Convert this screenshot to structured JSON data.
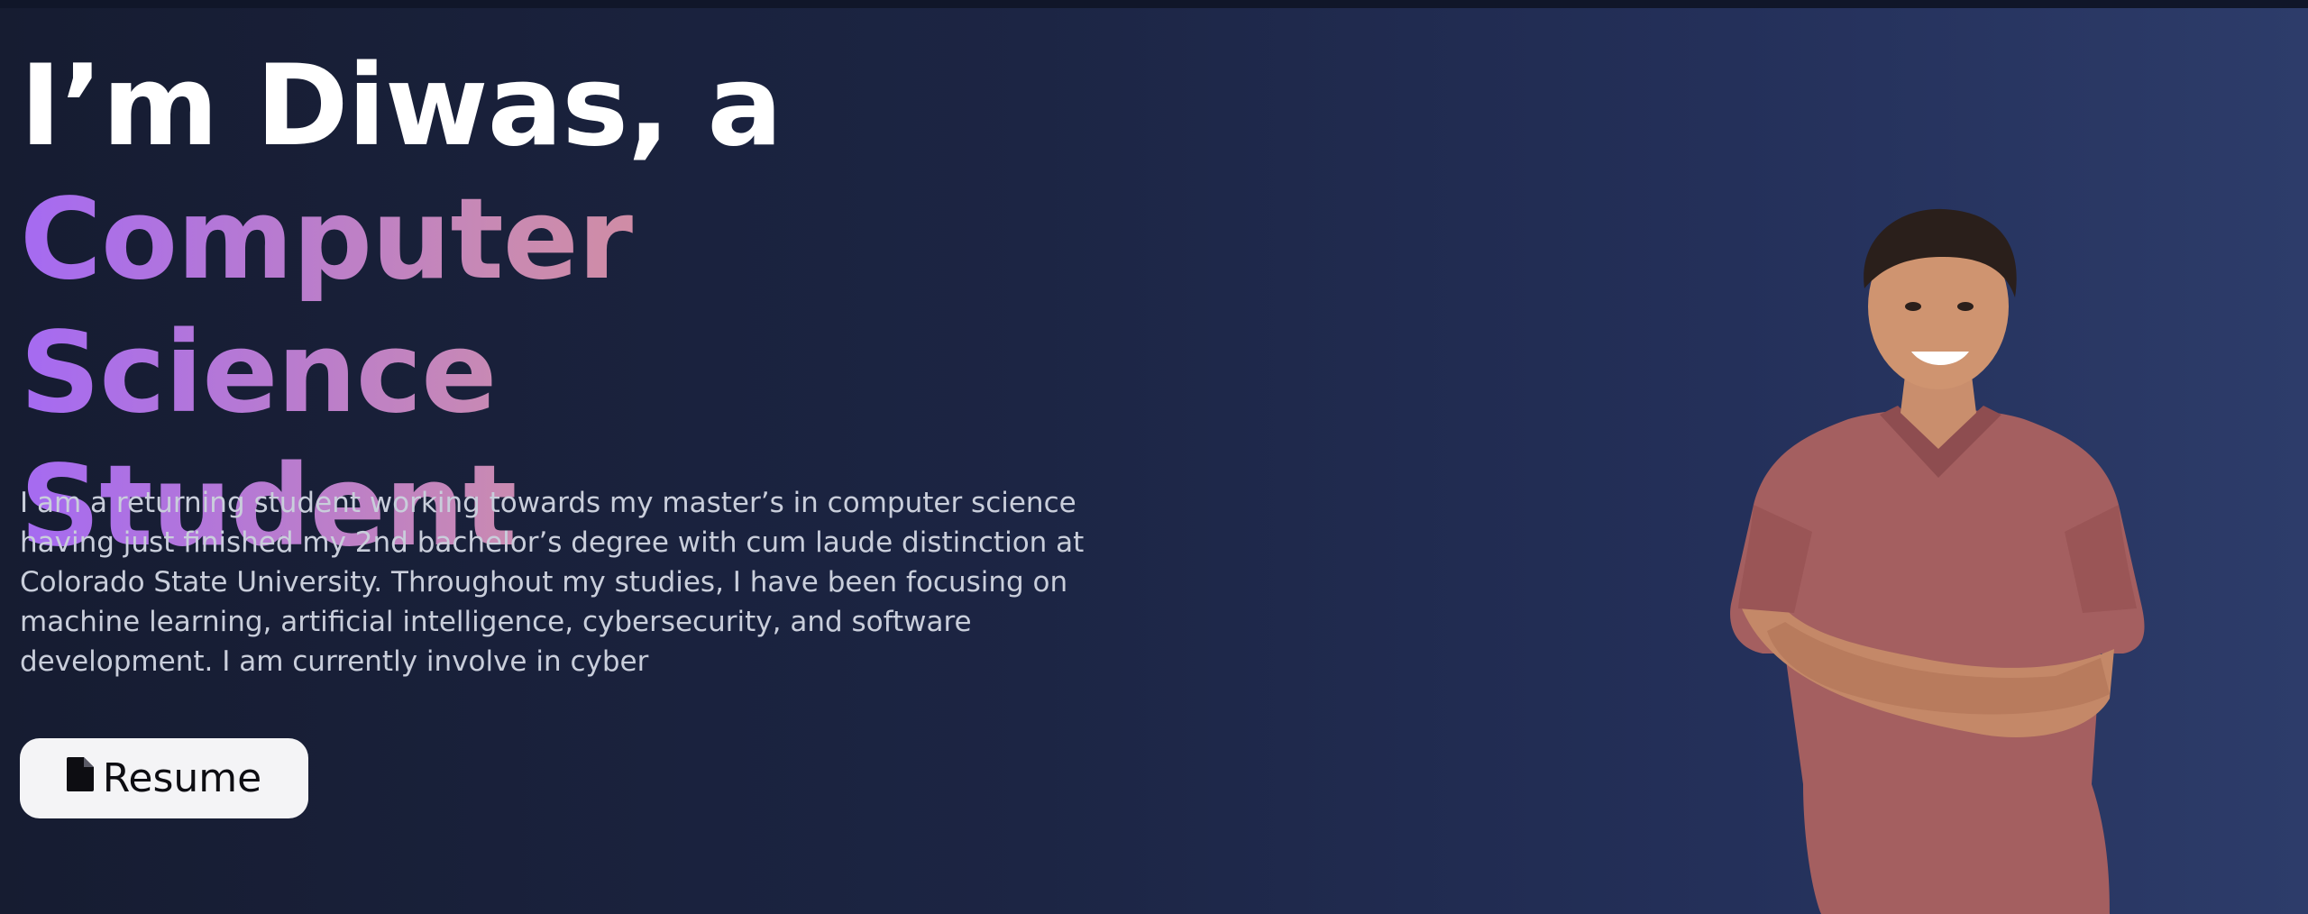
{
  "hero": {
    "headline_line1": "I’m Diwas, a",
    "headline_line2": "Computer Science",
    "headline_line3": "Student",
    "intro": "I am a returning student working towards my master’s in computer science having just finished my 2nd bachelor’s degree with cum laude distinction at Colorado State University. Throughout my studies, I have been focusing on machine learning, artificial intelligence, cybersecurity, and software development. I am currently involve in cyber",
    "resume_button": {
      "label": "Resume",
      "icon": "file-icon"
    }
  },
  "colors": {
    "background_start": "#161c31",
    "background_end": "#2d3c6a",
    "gradient_text_start": "#a56af2",
    "gradient_text_end": "#e89577",
    "button_bg": "#f4f4f6"
  }
}
